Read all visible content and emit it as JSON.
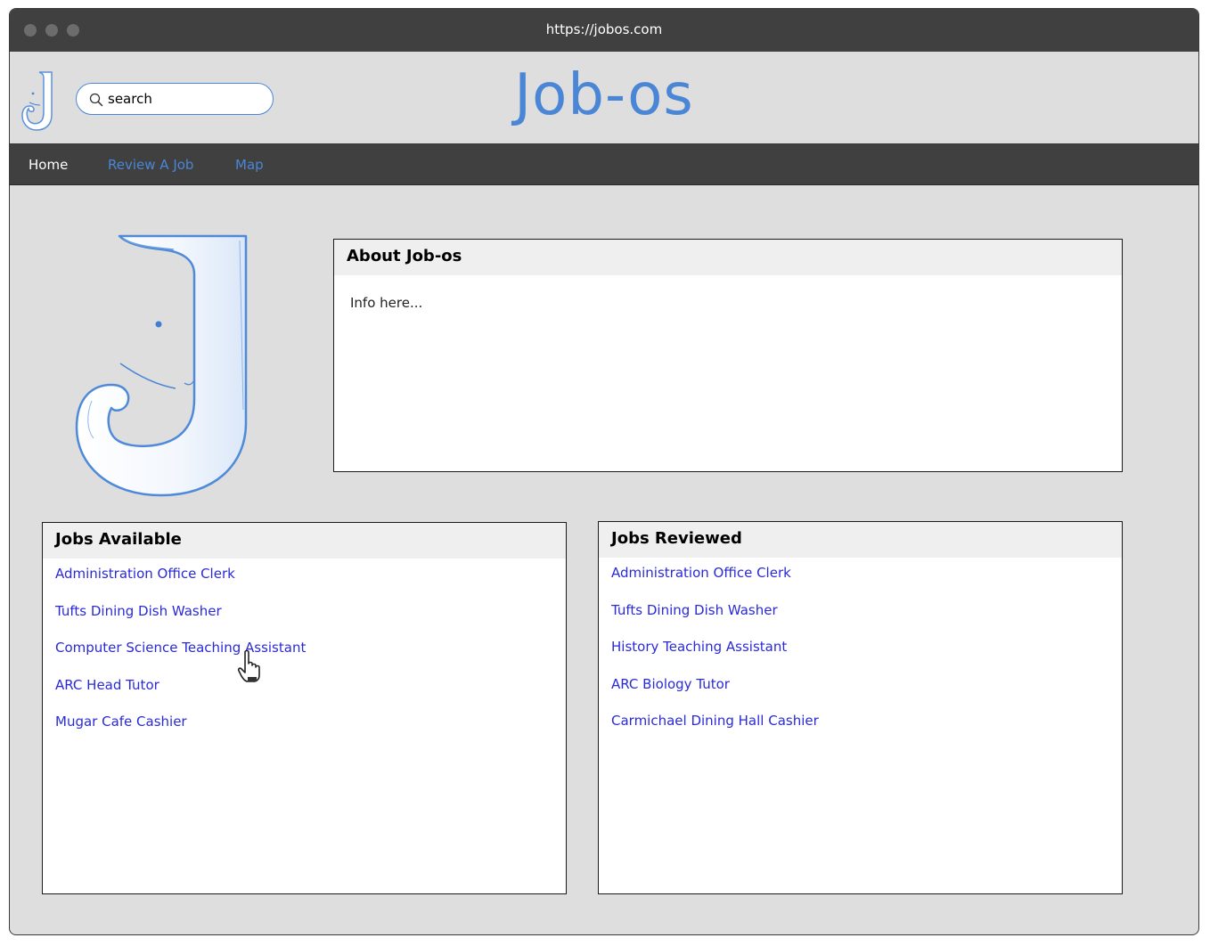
{
  "browser": {
    "url": "https://jobos.com"
  },
  "header": {
    "site_title": "Job-os",
    "search": {
      "value": "",
      "placeholder": "search"
    }
  },
  "nav": {
    "items": [
      {
        "label": "Home",
        "active": true
      },
      {
        "label": "Review A Job",
        "active": false
      },
      {
        "label": "Map",
        "active": false
      }
    ]
  },
  "about": {
    "title": "About Job-os",
    "body": "Info here..."
  },
  "jobs_available": {
    "title": "Jobs Available",
    "items": [
      "Administration Office Clerk",
      "Tufts Dining Dish Washer",
      "Computer Science Teaching Assistant",
      "ARC Head Tutor",
      "Mugar Cafe Cashier"
    ]
  },
  "jobs_reviewed": {
    "title": "Jobs Reviewed",
    "items": [
      "Administration Office Clerk",
      "Tufts Dining Dish Washer",
      "History Teaching Assistant",
      "ARC Biology Tutor",
      "Carmichael Dining Hall Cashier"
    ]
  },
  "colors": {
    "brand_blue": "#4a86d6",
    "link_blue": "#2a2ad8",
    "titlebar": "#404040",
    "page_background": "#dedede"
  },
  "icons": [
    "logo-j-icon",
    "search-icon",
    "hand-pointer-icon"
  ]
}
